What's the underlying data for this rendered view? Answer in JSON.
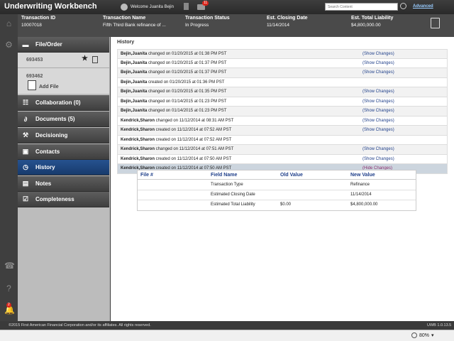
{
  "app": {
    "title": "Underwriting Workbench",
    "welcome": "Welcome Juanita Bejin",
    "mail_badge": "11",
    "search_placeholder": "Search Content",
    "advanced": "Advanced"
  },
  "transaction": {
    "columns": [
      {
        "label": "Transaction ID",
        "value": "10007018"
      },
      {
        "label": "Transaction Name",
        "value": "Fifth Third Bank refinance of ..."
      },
      {
        "label": "Transaction Status",
        "value": "In Progress"
      },
      {
        "label": "Est. Closing Date",
        "value": "11/14/2014"
      },
      {
        "label": "Est. Total Liability",
        "value": "$4,800,000.00"
      }
    ]
  },
  "sidenav": {
    "file_order": "File/Order",
    "files": [
      "693453",
      "693462"
    ],
    "add_file": "Add File",
    "items": [
      "Collaboration (0)",
      "Documents (5)",
      "Decisioning",
      "Contacts",
      "History",
      "Notes",
      "Completeness"
    ]
  },
  "history": {
    "title": "History",
    "rows": [
      {
        "user": "Bejin,Juanita",
        "action": " changed on 01/20/2015 at 01:38 PM PST",
        "link": "(Show Changes)"
      },
      {
        "user": "Bejin,Juanita",
        "action": " changed on 01/20/2015 at 01:37 PM PST",
        "link": "(Show Changes)"
      },
      {
        "user": "Bejin,Juanita",
        "action": " changed on 01/20/2015 at 01:37 PM PST",
        "link": "(Show Changes)"
      },
      {
        "user": "Bejin,Juanita",
        "action": " created on 01/20/2015 at 01:36 PM PST",
        "link": ""
      },
      {
        "user": "Bejin,Juanita",
        "action": " changed on 01/20/2015 at 01:35 PM PST",
        "link": "(Show Changes)"
      },
      {
        "user": "Bejin,Juanita",
        "action": " changed on 01/14/2015 at 01:23 PM PST",
        "link": "(Show Changes)"
      },
      {
        "user": "Bejin,Juanita",
        "action": " changed on 01/14/2015 at 01:23 PM PST",
        "link": "(Show Changes)"
      },
      {
        "user": "Kendrick,Sharon",
        "action": " changed on 11/12/2014 at 08:31 AM PST",
        "link": "(Show Changes)"
      },
      {
        "user": "Kendrick,Sharon",
        "action": " created on 11/12/2014 at 07:52 AM PST",
        "link": "(Show Changes)"
      },
      {
        "user": "Kendrick,Sharon",
        "action": " created on 11/12/2014 at 07:52 AM PST",
        "link": ""
      },
      {
        "user": "Kendrick,Sharon",
        "action": " changed on 11/12/2014 at 07:51 AM PST",
        "link": "(Show Changes)"
      },
      {
        "user": "Kendrick,Sharon",
        "action": " created on 11/12/2014 at 07:50 AM PST",
        "link": "(Show Changes)"
      },
      {
        "user": "Kendrick,Sharon",
        "action": " created on 11/12/2014 at 07:50 AM PST",
        "link": "(Hide Changes)"
      }
    ],
    "detail": {
      "headers": [
        "File #",
        "Field Name",
        "Old Value",
        "New Value"
      ],
      "rows": [
        [
          "",
          "Transaction Type",
          "",
          "Refinance"
        ],
        [
          "",
          "Estimated Closing Date",
          "",
          "11/14/2014"
        ],
        [
          "",
          "Estimated Total Liability",
          "$0.00",
          "$4,800,000.00"
        ]
      ]
    }
  },
  "footer": {
    "copyright": "©2015 First American Financial Corporation and/or its affiliates. All rights reserved.",
    "version": "UWB 1.0.13.5",
    "zoom": "80%",
    "alert_badge": "2"
  }
}
